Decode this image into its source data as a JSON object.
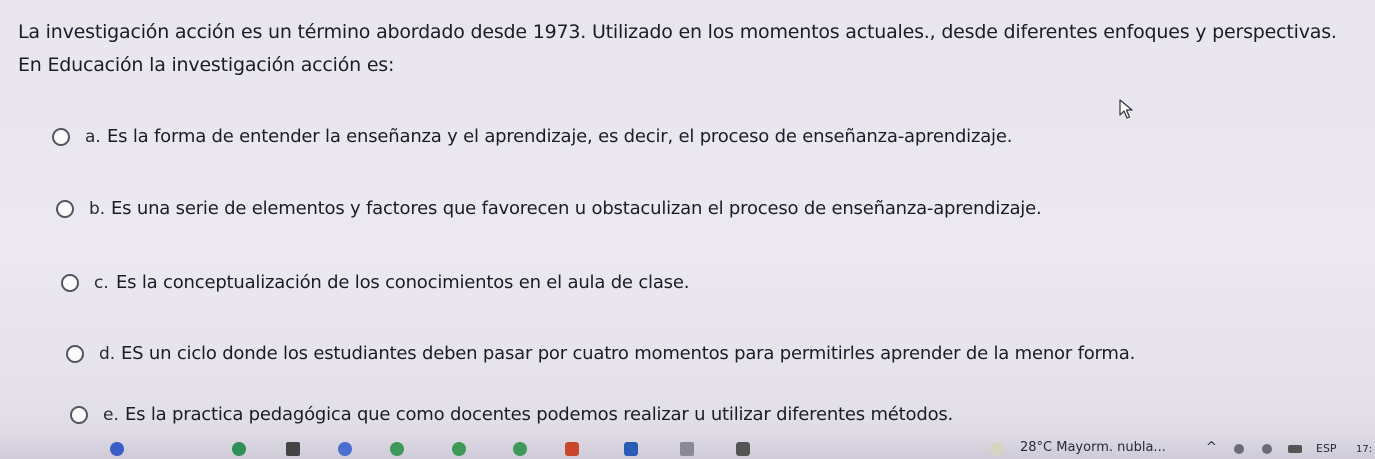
{
  "question": {
    "text": "La investigación acción es un término abordado desde 1973. Utilizado en los momentos actuales., desde diferentes enfoques y perspectivas. En Educación la investigación acción es:"
  },
  "options": [
    {
      "letter": "a.",
      "text": "Es la forma de entender la enseñanza y el aprendizaje, es decir, el proceso de enseñanza-aprendizaje."
    },
    {
      "letter": "b.",
      "text": "Es una serie de elementos y factores que favorecen u obstaculizan el proceso de enseñanza-aprendizaje."
    },
    {
      "letter": "c.",
      "text": "Es la conceptualización de los conocimientos en el aula de clase."
    },
    {
      "letter": "d.",
      "text": "ES un ciclo donde los estudiantes deben pasar por cuatro momentos para permitirles aprender de la menor forma."
    },
    {
      "letter": "e.",
      "text": "Es la practica pedagógica que como docentes podemos realizar u utilizar diferentes métodos."
    }
  ],
  "taskbar": {
    "weather": "28°C  Mayorm. nubla...",
    "language": "ESP",
    "time": "17:"
  }
}
